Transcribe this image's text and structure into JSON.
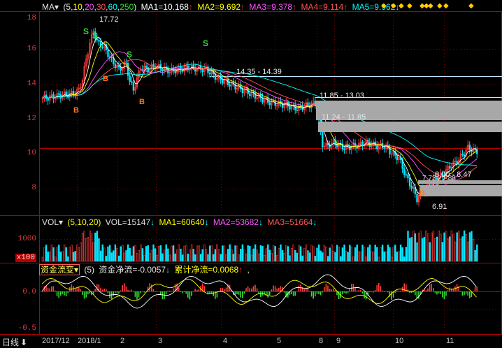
{
  "price_header": {
    "menu": "MA▾",
    "params": "(5,10,20,30,60,250)",
    "params_parts": [
      "(",
      "5",
      ",",
      "10",
      ",",
      "20",
      ",",
      "30",
      ",",
      "60",
      ",",
      "250",
      ")"
    ],
    "ma1": "MA1=10.168",
    "ma2": "MA2=9.692",
    "ma3": "MA3=9.378",
    "ma4": "MA4=9.114",
    "ma5": "MA5=9.962",
    "arrow_up": "↑",
    "arrow_down": "↓",
    "colors": {
      "ma1": "#ffffff",
      "ma2": "#ffff00",
      "ma3": "#ff55ff",
      "ma4": "#ff5555",
      "ma5": "#00ffff"
    }
  },
  "price_axis": [
    "18",
    "16",
    "14",
    "12",
    "10",
    "8"
  ],
  "price_annotations": {
    "high": "17.72",
    "low": "6.91",
    "range1": "14.35 - 14.39",
    "range2": "11.85 - 13.03",
    "range3": "11.24 - 11.85",
    "range4": "8.00 - 8.47",
    "range5": "7.73 - 7.88"
  },
  "signals": {
    "buy": "B",
    "sell": "S"
  },
  "vol_header": {
    "menu": "VOL▾",
    "params": "(5,10,20)",
    "vol": "VOL=15147",
    "ma1": "MA1=60640",
    "ma2": "MA2=53682",
    "ma3": "MA3=51664",
    "arrow_down": "↓"
  },
  "vol_axis": {
    "top": "1000",
    "unit": "x100"
  },
  "flow_header": {
    "menu": "资金流变▾",
    "params": "(5)",
    "net": "资金净流=-0.0057",
    "cum": "累计净流=0.0068",
    "arrow_up": "↑",
    "arrow_down": "↓",
    "tail": ","
  },
  "flow_axis": [
    "0.0",
    "-0.5"
  ],
  "bottom_bar": {
    "period": "日线",
    "period_arrow": "⬇",
    "labels": [
      "2017/12",
      "2018/1",
      "2",
      "3",
      "4",
      "5",
      "8",
      "9",
      "10",
      "11"
    ]
  },
  "colors": {
    "up": "#ff3c3c",
    "down": "#00e5ff",
    "grid": "#8b0000",
    "axis_text": "#d23c3c"
  }
}
